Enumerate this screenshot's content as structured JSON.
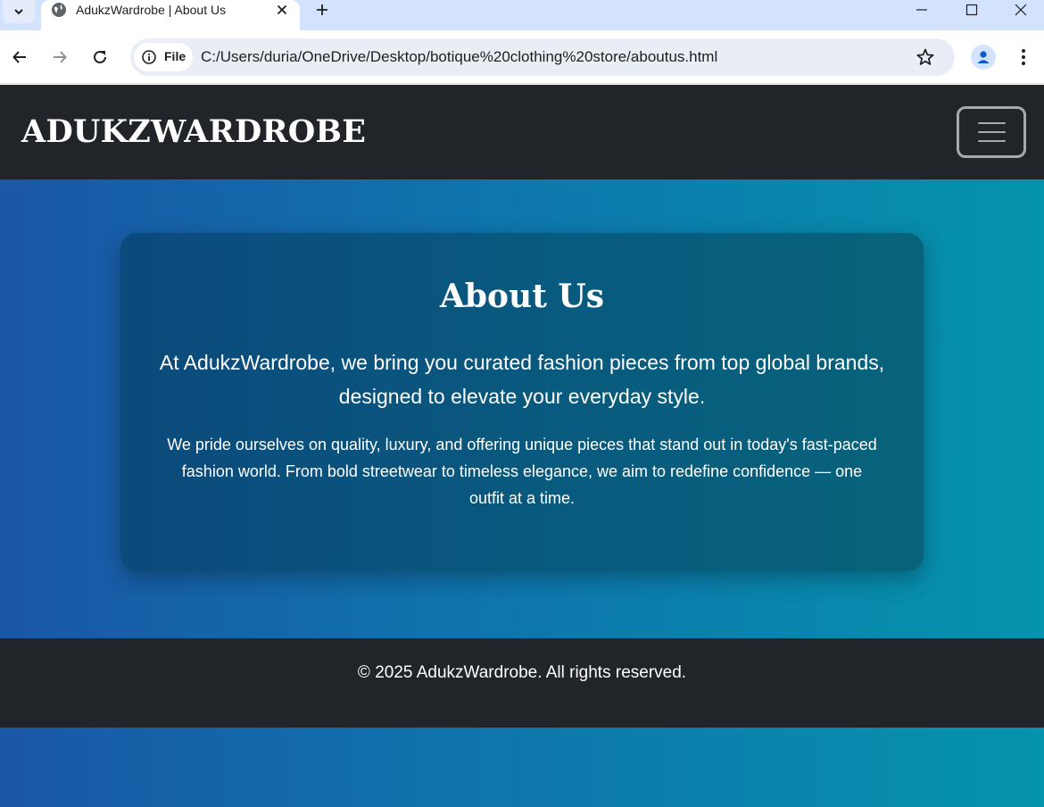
{
  "browser": {
    "tab_title": "AdukzWardrobe | About Us",
    "new_tab_symbol": "+",
    "site_info_label": "File",
    "url": "C:/Users/duria/OneDrive/Desktop/botique%20clothing%20store/aboutus.html",
    "icons": [
      "tab-search-icon",
      "globe-icon",
      "close-icon",
      "plus-icon",
      "minimize-icon",
      "maximize-icon",
      "window-close-icon",
      "back-icon",
      "forward-icon",
      "reload-icon",
      "info-icon",
      "star-icon",
      "profile-icon",
      "more-icon"
    ]
  },
  "navbar": {
    "brand": "ADUKZWARDROBE",
    "toggler_icon": "hamburger-icon"
  },
  "about": {
    "title": "About Us",
    "lead": "At AdukzWardrobe, we bring you curated fashion pieces from top global brands, designed to elevate your everyday style.",
    "body": "We pride ourselves on quality, luxury, and offering unique pieces that stand out in today's fast-paced fashion world. From bold streetwear to timeless elegance, we aim to redefine confidence — one outfit at a time."
  },
  "footer": {
    "text": "© 2025 AdukzWardrobe. All rights reserved."
  },
  "colors": {
    "navbar_bg": "#212429",
    "gradient_start": "#1a57a6",
    "gradient_end": "#0593ad",
    "card_bg": "#095a7f",
    "text": "#ffffff"
  }
}
